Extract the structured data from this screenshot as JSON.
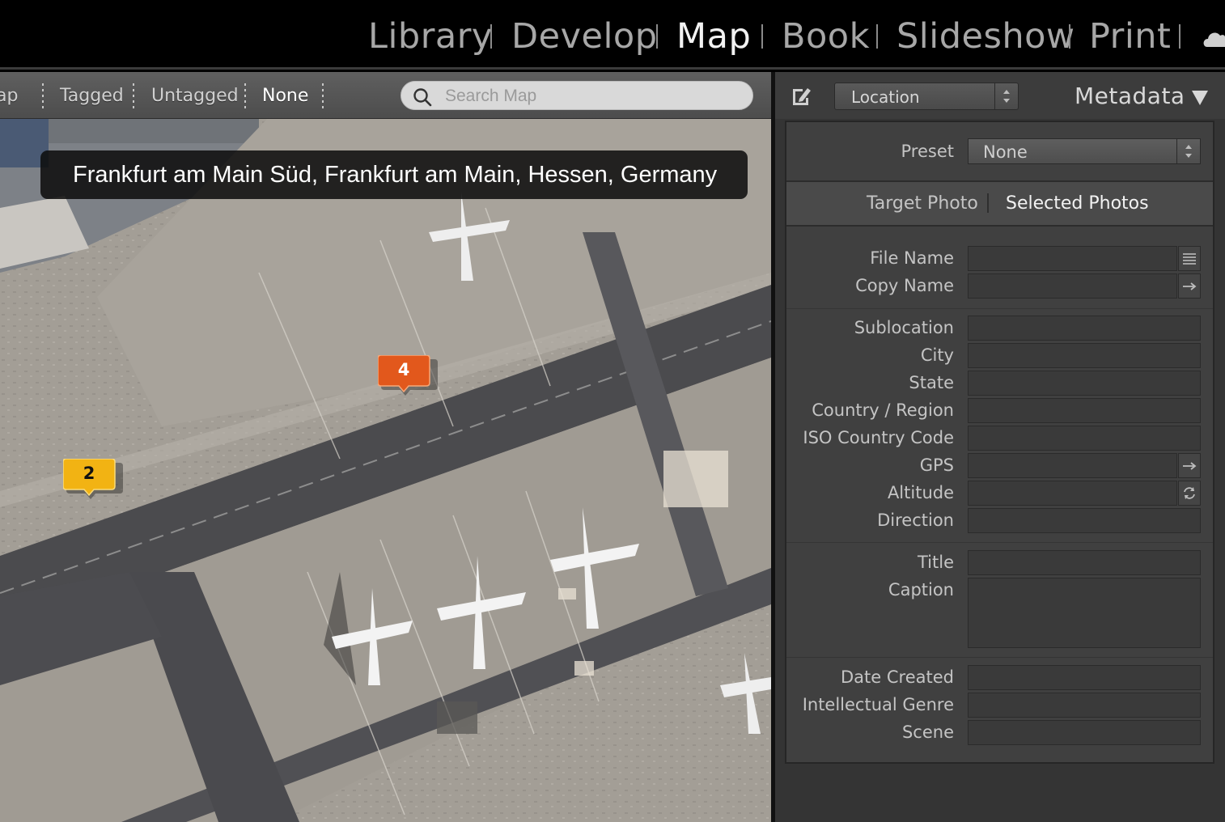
{
  "modules": {
    "items": [
      {
        "label": "Library",
        "active": false
      },
      {
        "label": "Develop",
        "active": false
      },
      {
        "label": "Map",
        "active": true
      },
      {
        "label": "Book",
        "active": false
      },
      {
        "label": "Slideshow",
        "active": false
      },
      {
        "label": "Print",
        "active": false
      }
    ],
    "separator": "|",
    "cloud_icon": "cloud-icon"
  },
  "map_toolbar": {
    "filters": [
      {
        "label": "Map",
        "active": false
      },
      {
        "label": "Tagged",
        "active": false
      },
      {
        "label": "Untagged",
        "active": false
      },
      {
        "label": "None",
        "active": true
      }
    ],
    "search_placeholder": "Search Map",
    "search_value": "",
    "search_icon": "search-icon"
  },
  "map": {
    "location_label": "Frankfurt am Main Süd, Frankfurt am Main, Hessen, Germany",
    "pins": [
      {
        "count": "4",
        "color": "#e2581c"
      },
      {
        "count": "2",
        "color": "#f2b313"
      }
    ]
  },
  "panel": {
    "edit_icon": "edit-icon",
    "location_select": "Location",
    "title": "Metadata",
    "preset_label": "Preset",
    "preset_value": "None",
    "tabs": [
      {
        "label": "Target Photo",
        "active": false
      },
      {
        "label": "Selected Photos",
        "active": true
      }
    ],
    "fields": {
      "file_name": "File Name",
      "copy_name": "Copy Name",
      "sublocation": "Sublocation",
      "city": "City",
      "state": "State",
      "country": "Country / Region",
      "iso_code": "ISO Country Code",
      "gps": "GPS",
      "altitude": "Altitude",
      "direction": "Direction",
      "title": "Title",
      "caption": "Caption",
      "date_created": "Date Created",
      "genre": "Intellectual Genre",
      "scene": "Scene"
    }
  },
  "colors": {
    "background": "#000000",
    "panel": "#343434",
    "panel_box": "#404040",
    "active_module": "#f2f2f2",
    "inactive_module": "#a7a7a7"
  }
}
